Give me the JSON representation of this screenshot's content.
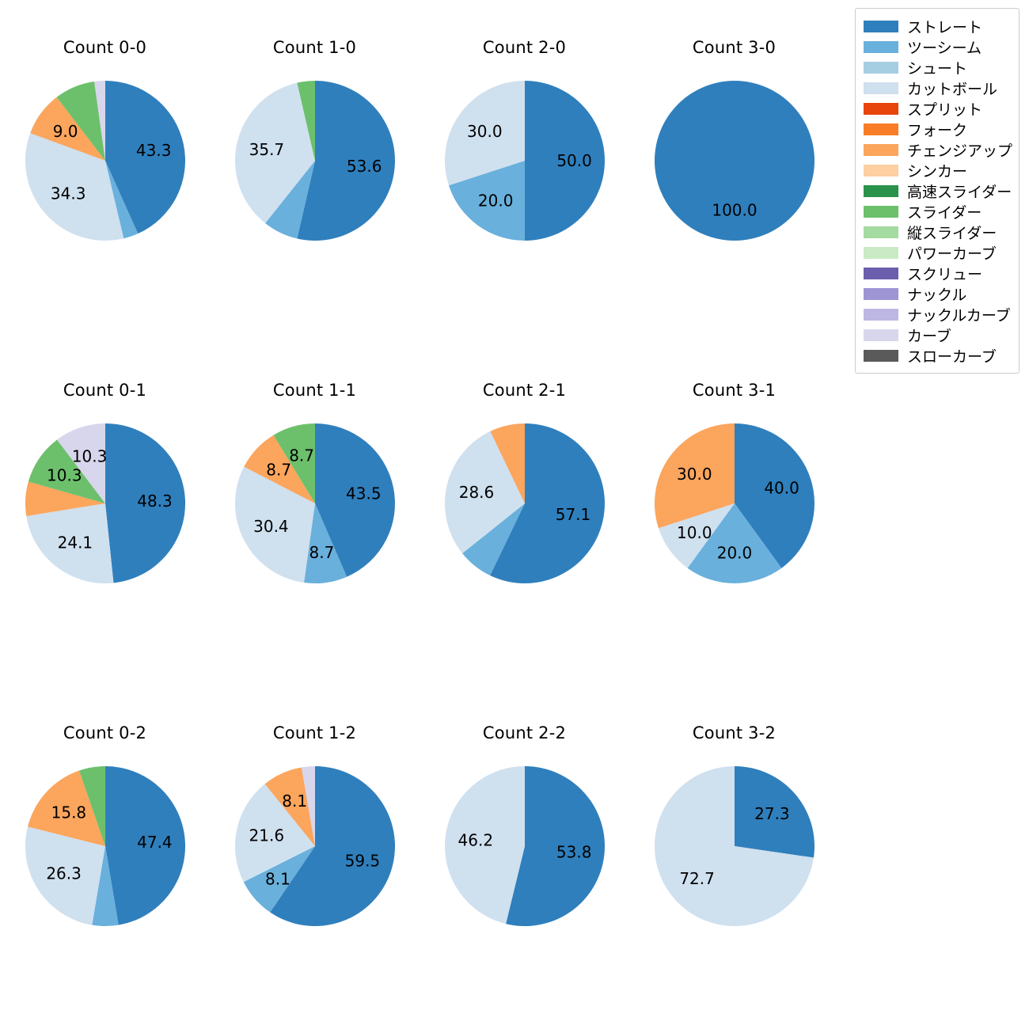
{
  "legend": {
    "position": "top-right",
    "items": [
      {
        "label": "ストレート",
        "color": "#2f7fbd"
      },
      {
        "label": "ツーシーム",
        "color": "#69b0dc"
      },
      {
        "label": "シュート",
        "color": "#a6cee3"
      },
      {
        "label": "カットボール",
        "color": "#cfe0ef"
      },
      {
        "label": "スプリット",
        "color": "#e8450c"
      },
      {
        "label": "フォーク",
        "color": "#f97d27"
      },
      {
        "label": "チェンジアップ",
        "color": "#fba55d"
      },
      {
        "label": "シンカー",
        "color": "#fdcfa1"
      },
      {
        "label": "高速スライダー",
        "color": "#2a924a"
      },
      {
        "label": "スライダー",
        "color": "#6cc06c"
      },
      {
        "label": "縦スライダー",
        "color": "#a4dba1"
      },
      {
        "label": "パワーカーブ",
        "color": "#caeac5"
      },
      {
        "label": "スクリュー",
        "color": "#6a5ead"
      },
      {
        "label": "ナックル",
        "color": "#9e95d4"
      },
      {
        "label": "ナックルカーブ",
        "color": "#bcb8e3"
      },
      {
        "label": "カーブ",
        "color": "#d7d6ec"
      },
      {
        "label": "スローカーブ",
        "color": "#5a5a5a"
      }
    ]
  },
  "chart_data": [
    {
      "type": "pie",
      "title": "Count 0-0",
      "labels": [
        "ストレート",
        "ツーシーム",
        "カットボール",
        "チェンジアップ",
        "スライダー",
        "カーブ"
      ],
      "values": [
        43.3,
        3.0,
        34.3,
        9.0,
        8.2,
        2.2
      ],
      "colors": [
        "#2f7fbd",
        "#69b0dc",
        "#cfe0ef",
        "#fba55d",
        "#6cc06c",
        "#d7d6ec"
      ],
      "shown_labels": [
        "43.3",
        "",
        "34.3",
        "9.0",
        "",
        ""
      ]
    },
    {
      "type": "pie",
      "title": "Count 1-0",
      "labels": [
        "ストレート",
        "ツーシーム",
        "カットボール",
        "スライダー"
      ],
      "values": [
        53.6,
        7.1,
        35.7,
        3.6
      ],
      "colors": [
        "#2f7fbd",
        "#69b0dc",
        "#cfe0ef",
        "#6cc06c"
      ],
      "shown_labels": [
        "53.6",
        "",
        "35.7",
        ""
      ]
    },
    {
      "type": "pie",
      "title": "Count 2-0",
      "labels": [
        "ストレート",
        "ツーシーム",
        "カットボール"
      ],
      "values": [
        50.0,
        20.0,
        30.0
      ],
      "colors": [
        "#2f7fbd",
        "#69b0dc",
        "#cfe0ef"
      ],
      "shown_labels": [
        "50.0",
        "20.0",
        "30.0"
      ]
    },
    {
      "type": "pie",
      "title": "Count 3-0",
      "labels": [
        "ストレート"
      ],
      "values": [
        100.0
      ],
      "colors": [
        "#2f7fbd"
      ],
      "shown_labels": [
        "100.0"
      ]
    },
    {
      "type": "pie",
      "title": "Count 0-1",
      "labels": [
        "ストレート",
        "カットボール",
        "チェンジアップ",
        "スライダー",
        "カーブ"
      ],
      "values": [
        48.3,
        24.1,
        6.9,
        10.3,
        10.3
      ],
      "colors": [
        "#2f7fbd",
        "#cfe0ef",
        "#fba55d",
        "#6cc06c",
        "#d7d6ec"
      ],
      "shown_labels": [
        "48.3",
        "24.1",
        "",
        "10.3",
        "10.3"
      ]
    },
    {
      "type": "pie",
      "title": "Count 1-1",
      "labels": [
        "ストレート",
        "ツーシーム",
        "カットボール",
        "チェンジアップ",
        "スライダー"
      ],
      "values": [
        43.5,
        8.7,
        30.4,
        8.7,
        8.7
      ],
      "colors": [
        "#2f7fbd",
        "#69b0dc",
        "#cfe0ef",
        "#fba55d",
        "#6cc06c"
      ],
      "shown_labels": [
        "43.5",
        "8.7",
        "30.4",
        "8.7",
        "8.7"
      ]
    },
    {
      "type": "pie",
      "title": "Count 2-1",
      "labels": [
        "ストレート",
        "ツーシーム",
        "カットボール",
        "チェンジアップ"
      ],
      "values": [
        57.1,
        7.1,
        28.6,
        7.1
      ],
      "colors": [
        "#2f7fbd",
        "#69b0dc",
        "#cfe0ef",
        "#fba55d"
      ],
      "shown_labels": [
        "57.1",
        "",
        "28.6",
        ""
      ]
    },
    {
      "type": "pie",
      "title": "Count 3-1",
      "labels": [
        "ストレート",
        "ツーシーム",
        "カットボール",
        "チェンジアップ"
      ],
      "values": [
        40.0,
        20.0,
        10.0,
        30.0
      ],
      "colors": [
        "#2f7fbd",
        "#69b0dc",
        "#cfe0ef",
        "#fba55d"
      ],
      "shown_labels": [
        "40.0",
        "20.0",
        "10.0",
        "30.0"
      ]
    },
    {
      "type": "pie",
      "title": "Count 0-2",
      "labels": [
        "ストレート",
        "ツーシーム",
        "カットボール",
        "チェンジアップ",
        "スライダー"
      ],
      "values": [
        47.4,
        5.3,
        26.3,
        15.8,
        5.3
      ],
      "colors": [
        "#2f7fbd",
        "#69b0dc",
        "#cfe0ef",
        "#fba55d",
        "#6cc06c"
      ],
      "shown_labels": [
        "47.4",
        "",
        "26.3",
        "15.8",
        ""
      ]
    },
    {
      "type": "pie",
      "title": "Count 1-2",
      "labels": [
        "ストレート",
        "ツーシーム",
        "カットボール",
        "チェンジアップ",
        "カーブ"
      ],
      "values": [
        59.5,
        8.1,
        21.6,
        8.1,
        2.7
      ],
      "colors": [
        "#2f7fbd",
        "#69b0dc",
        "#cfe0ef",
        "#fba55d",
        "#d7d6ec"
      ],
      "shown_labels": [
        "59.5",
        "8.1",
        "21.6",
        "8.1",
        ""
      ]
    },
    {
      "type": "pie",
      "title": "Count 2-2",
      "labels": [
        "ストレート",
        "カットボール"
      ],
      "values": [
        53.8,
        46.2
      ],
      "colors": [
        "#2f7fbd",
        "#cfe0ef"
      ],
      "shown_labels": [
        "53.8",
        "46.2"
      ]
    },
    {
      "type": "pie",
      "title": "Count 3-2",
      "labels": [
        "ストレート",
        "カットボール"
      ],
      "values": [
        27.3,
        72.7
      ],
      "colors": [
        "#2f7fbd",
        "#cfe0ef"
      ],
      "shown_labels": [
        "27.3",
        "72.7"
      ]
    }
  ]
}
